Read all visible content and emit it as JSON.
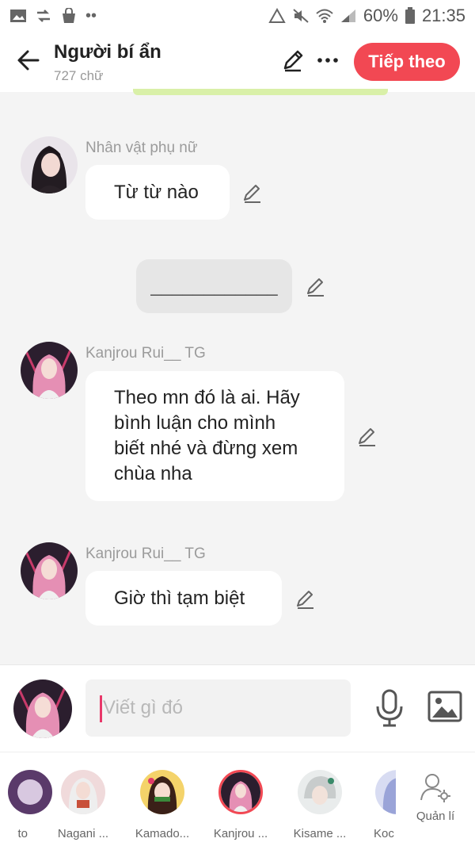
{
  "status_bar": {
    "battery": "60%",
    "time": "21:35",
    "icons": [
      "gallery-icon",
      "share-icon",
      "bag-icon",
      "dots-icon",
      "recycle-icon",
      "mute-icon",
      "wifi-icon",
      "signal-icon",
      "battery-icon"
    ]
  },
  "header": {
    "title": "Người bí ẩn",
    "subtitle": "727 chữ",
    "next_label": "Tiếp theo",
    "accent": "#f24853"
  },
  "messages": [
    {
      "sender": "Nhân vật phụ nữ",
      "text": "Từ từ nào",
      "avatar": "female-character-avatar"
    },
    {
      "sender": "",
      "text": "____________",
      "narration": true
    },
    {
      "sender": "Kanjrou Rui__ TG",
      "lines": [
        "Theo mn đó là ai. Hãy",
        "bình luận cho mình",
        "biết nhé và đừng xem",
        "chùa nha"
      ],
      "avatar": "kanjrou-avatar"
    },
    {
      "sender": "Kanjrou Rui__ TG",
      "text": "Giờ thì tạm biệt",
      "avatar": "kanjrou-avatar"
    }
  ],
  "input": {
    "placeholder": "Viết gì đó"
  },
  "characters": [
    {
      "name": "to"
    },
    {
      "name": "Nagani ..."
    },
    {
      "name": "Kamado..."
    },
    {
      "name": "Kanjrou ...",
      "selected": true
    },
    {
      "name": "Kisame ..."
    },
    {
      "name": "Koc"
    }
  ],
  "manage_label": "Quản lí"
}
